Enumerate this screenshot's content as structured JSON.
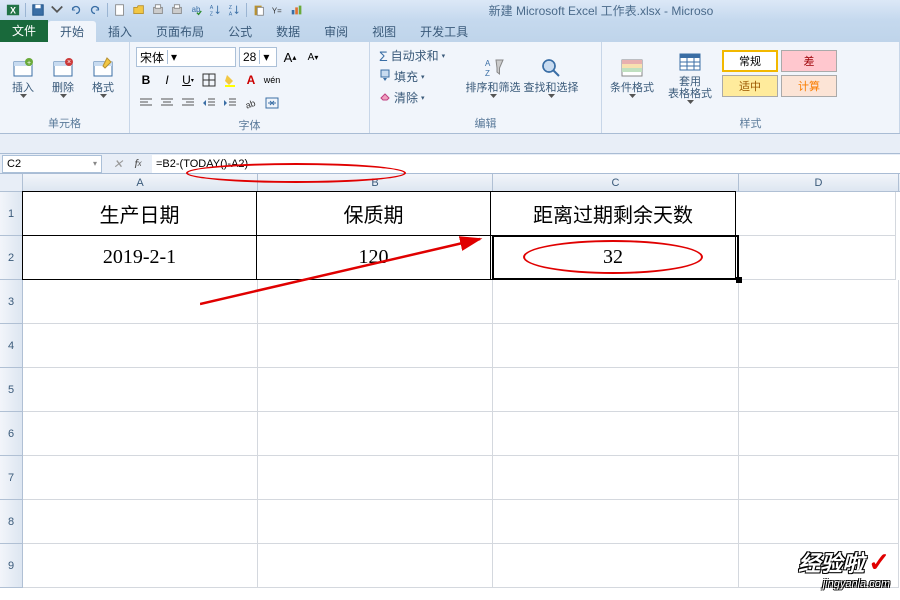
{
  "title": "新建 Microsoft Excel 工作表.xlsx - Microso",
  "tabs": {
    "file": "文件",
    "items": [
      "开始",
      "插入",
      "页面布局",
      "公式",
      "数据",
      "审阅",
      "视图",
      "开发工具"
    ]
  },
  "ribbon": {
    "cells_group": "单元格",
    "insert": "插入",
    "delete": "删除",
    "format": "格式",
    "font_group": "字体",
    "font_name": "宋体",
    "font_size": "28",
    "edit_group": "编辑",
    "autosum": "自动求和",
    "fill": "填充",
    "clear": "清除",
    "sort_filter": "排序和筛选",
    "find_select": "查找和选择",
    "cond_format": "条件格式",
    "table_format": "套用\n表格格式",
    "styles_group": "样式",
    "style_normal": "常规",
    "style_bad": "差",
    "style_neutral": "适中",
    "style_calc": "计算"
  },
  "formula_bar": {
    "cell_ref": "C2",
    "formula": "=B2-(TODAY()-A2)"
  },
  "columns": [
    "A",
    "B",
    "C",
    "D"
  ],
  "rows": [
    "1",
    "2",
    "3",
    "4",
    "5",
    "6",
    "7",
    "8",
    "9"
  ],
  "grid": {
    "a1": "生产日期",
    "b1": "保质期",
    "c1": "距离过期剩余天数",
    "a2": "2019-2-1",
    "b2": "120",
    "c2": "32"
  },
  "watermark": {
    "main": "经验啦",
    "sub": "jingyanla.com"
  }
}
